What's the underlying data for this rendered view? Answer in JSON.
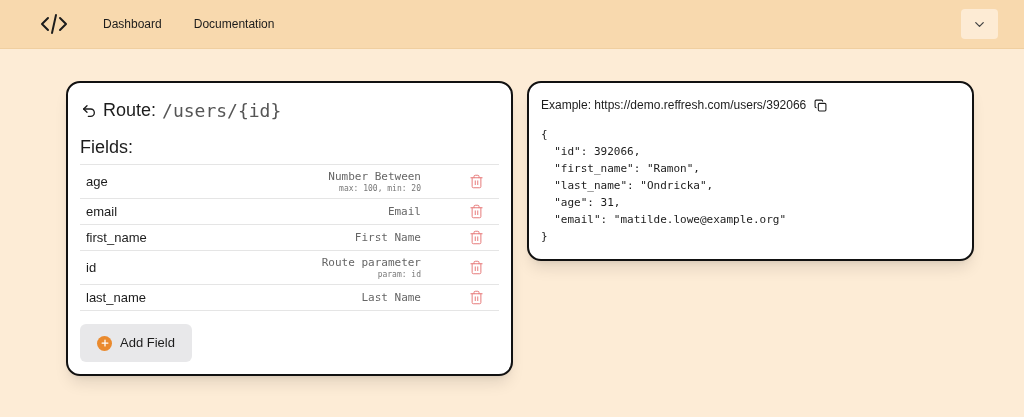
{
  "nav": {
    "links": [
      {
        "label": "Dashboard"
      },
      {
        "label": "Documentation"
      }
    ]
  },
  "route": {
    "label": "Route:",
    "path": "/users/{id}"
  },
  "fields_heading": "Fields:",
  "fields": [
    {
      "name": "age",
      "type": "Number Between",
      "detail": "max: 100, min: 20"
    },
    {
      "name": "email",
      "type": "Email"
    },
    {
      "name": "first_name",
      "type": "First Name"
    },
    {
      "name": "id",
      "type": "Route parameter",
      "detail": "param: id"
    },
    {
      "name": "last_name",
      "type": "Last Name"
    }
  ],
  "add_button": "Add Field",
  "example": {
    "label": "Example: https://demo.reffresh.com/users/392066",
    "code_lines": [
      "{",
      "  \"id\": 392066,",
      "  \"first_name\": \"Ramon\",",
      "  \"last_name\": \"Ondricka\",",
      "  \"age\": 31,",
      "  \"email\": \"matilde.lowe@example.org\"",
      "}"
    ]
  }
}
